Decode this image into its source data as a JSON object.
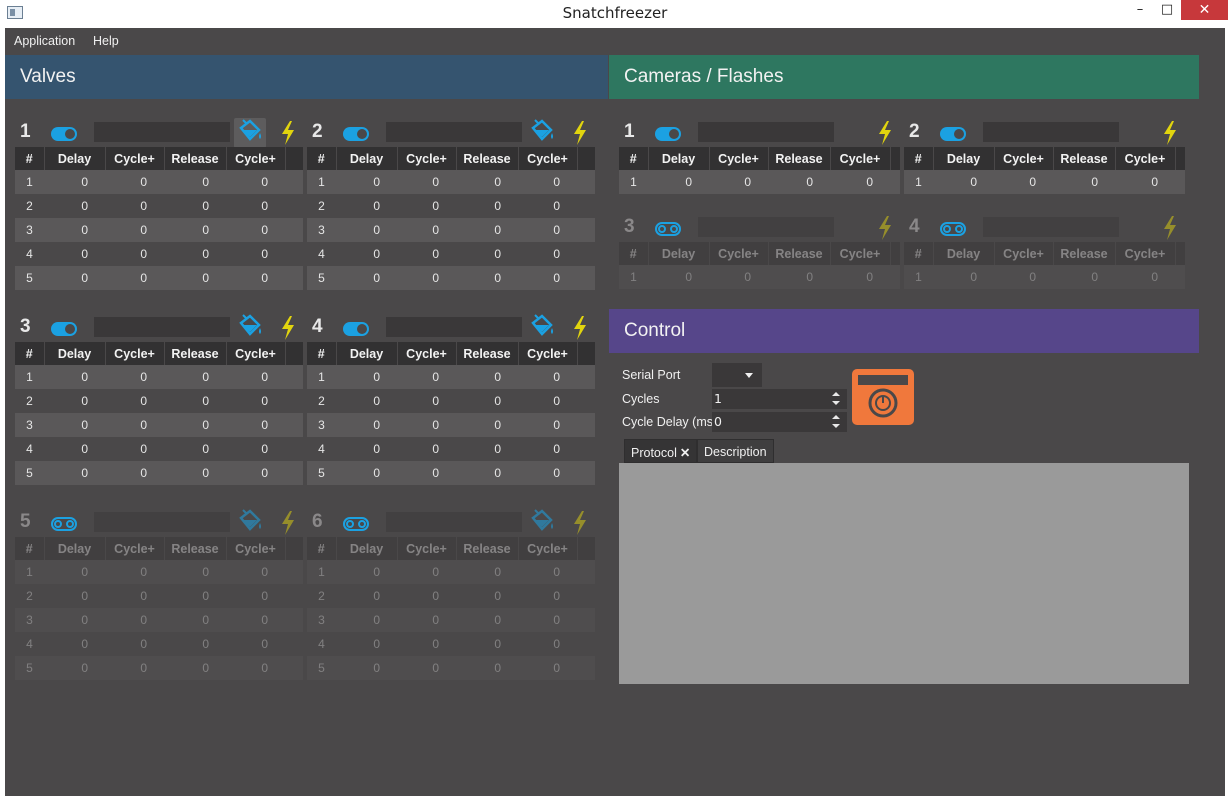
{
  "window": {
    "title": "Snatchfreezer",
    "minimize": "–",
    "maximize": "□",
    "close": "✕"
  },
  "menu": {
    "application": "Application",
    "help": "Help"
  },
  "sections": {
    "valves": "Valves",
    "cameras": "Cameras / Flashes",
    "control": "Control"
  },
  "colors": {
    "valves_header": "#35546f",
    "cameras_header": "#2e7760",
    "control_header": "#56468a",
    "accent": "#1ba1e2",
    "bolt": "#e1d40e",
    "camera_button": "#f0783c"
  },
  "columns": [
    "#",
    "Delay",
    "Cycle+",
    "Release",
    "Cycle+"
  ],
  "valves": [
    {
      "num": "1",
      "enabled": true,
      "rows": [
        [
          "1",
          "0",
          "0",
          "0",
          "0"
        ],
        [
          "2",
          "0",
          "0",
          "0",
          "0"
        ],
        [
          "3",
          "0",
          "0",
          "0",
          "0"
        ],
        [
          "4",
          "0",
          "0",
          "0",
          "0"
        ],
        [
          "5",
          "0",
          "0",
          "0",
          "0"
        ]
      ]
    },
    {
      "num": "2",
      "enabled": true,
      "rows": [
        [
          "1",
          "0",
          "0",
          "0",
          "0"
        ],
        [
          "2",
          "0",
          "0",
          "0",
          "0"
        ],
        [
          "3",
          "0",
          "0",
          "0",
          "0"
        ],
        [
          "4",
          "0",
          "0",
          "0",
          "0"
        ],
        [
          "5",
          "0",
          "0",
          "0",
          "0"
        ]
      ]
    },
    {
      "num": "3",
      "enabled": true,
      "rows": [
        [
          "1",
          "0",
          "0",
          "0",
          "0"
        ],
        [
          "2",
          "0",
          "0",
          "0",
          "0"
        ],
        [
          "3",
          "0",
          "0",
          "0",
          "0"
        ],
        [
          "4",
          "0",
          "0",
          "0",
          "0"
        ],
        [
          "5",
          "0",
          "0",
          "0",
          "0"
        ]
      ]
    },
    {
      "num": "4",
      "enabled": true,
      "rows": [
        [
          "1",
          "0",
          "0",
          "0",
          "0"
        ],
        [
          "2",
          "0",
          "0",
          "0",
          "0"
        ],
        [
          "3",
          "0",
          "0",
          "0",
          "0"
        ],
        [
          "4",
          "0",
          "0",
          "0",
          "0"
        ],
        [
          "5",
          "0",
          "0",
          "0",
          "0"
        ]
      ]
    },
    {
      "num": "5",
      "enabled": false,
      "rows": [
        [
          "1",
          "0",
          "0",
          "0",
          "0"
        ],
        [
          "2",
          "0",
          "0",
          "0",
          "0"
        ],
        [
          "3",
          "0",
          "0",
          "0",
          "0"
        ],
        [
          "4",
          "0",
          "0",
          "0",
          "0"
        ],
        [
          "5",
          "0",
          "0",
          "0",
          "0"
        ]
      ]
    },
    {
      "num": "6",
      "enabled": false,
      "rows": [
        [
          "1",
          "0",
          "0",
          "0",
          "0"
        ],
        [
          "2",
          "0",
          "0",
          "0",
          "0"
        ],
        [
          "3",
          "0",
          "0",
          "0",
          "0"
        ],
        [
          "4",
          "0",
          "0",
          "0",
          "0"
        ],
        [
          "5",
          "0",
          "0",
          "0",
          "0"
        ]
      ]
    }
  ],
  "cameras": [
    {
      "num": "1",
      "enabled": true,
      "rows": [
        [
          "1",
          "0",
          "0",
          "0",
          "0"
        ]
      ]
    },
    {
      "num": "2",
      "enabled": true,
      "rows": [
        [
          "1",
          "0",
          "0",
          "0",
          "0"
        ]
      ]
    },
    {
      "num": "3",
      "enabled": false,
      "rows": [
        [
          "1",
          "0",
          "0",
          "0",
          "0"
        ]
      ]
    },
    {
      "num": "4",
      "enabled": false,
      "rows": [
        [
          "1",
          "0",
          "0",
          "0",
          "0"
        ]
      ]
    }
  ],
  "control": {
    "serial_port_label": "Serial Port",
    "serial_port_value": "",
    "cycles_label": "Cycles",
    "cycles_value": "1",
    "cycle_delay_label": "Cycle Delay (ms)",
    "cycle_delay_value": "0",
    "tabs": [
      {
        "label": "Protocol",
        "close": "✕"
      },
      {
        "label": "Description"
      }
    ]
  }
}
